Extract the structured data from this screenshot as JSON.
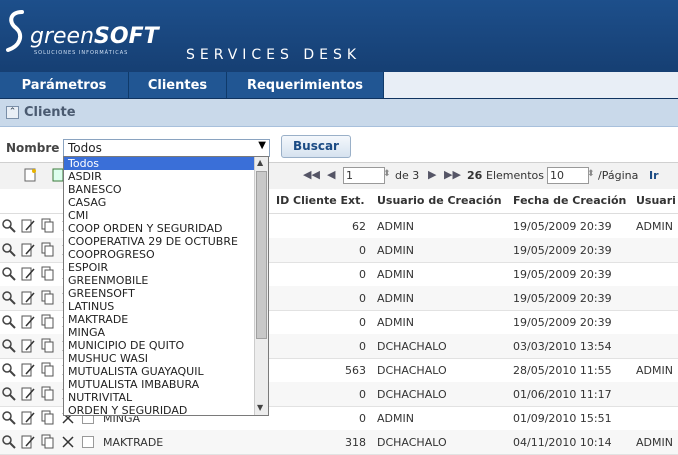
{
  "brand": {
    "name_a": "green",
    "name_b": "SOFT",
    "tagline": "SOLUCIONES INFORMÁTICAS",
    "app_title": "SERVICES DESK"
  },
  "nav": [
    "Parámetros",
    "Clientes",
    "Requerimientos"
  ],
  "section": {
    "title": "Cliente"
  },
  "filter": {
    "label": "Nombre",
    "selected": "Todos",
    "search_label": "Buscar"
  },
  "dropdown": {
    "options": [
      "Todos",
      "ASDIR",
      "BANESCO",
      "CASAG",
      "CMI",
      "COOP ORDEN Y SEGURIDAD",
      "COOPERATIVA 29 DE OCTUBRE",
      "COOPROGRESO",
      "ESPOIR",
      "GREENMOBILE",
      "GREENSOFT",
      "LATINUS",
      "MAKTRADE",
      "MINGA",
      "MUNICIPIO DE QUITO",
      "MUSHUC WASI",
      "MUTUALISTA GUAYAQUIL",
      "MUTUALISTA IMBABURA",
      "NUTRIVITAL",
      "ORDEN Y SEGURIDAD"
    ]
  },
  "pager": {
    "page": "1",
    "of_label": "de 3",
    "count": "26",
    "elements_label": "Elementos",
    "per_page": "10",
    "per_page_label": "/Página",
    "go_label": "Ir"
  },
  "columns": [
    "ID Cliente Ext.",
    "Usuario de Creación",
    "Fecha de Creación",
    "Usuari"
  ],
  "rows": [
    {
      "name": "",
      "id": "62",
      "user": "ADMIN",
      "date": "19/05/2009 20:39",
      "user2": "ADMIN"
    },
    {
      "name": "",
      "id": "0",
      "user": "ADMIN",
      "date": "19/05/2009 20:39",
      "user2": ""
    },
    {
      "name": "",
      "id": "0",
      "user": "ADMIN",
      "date": "19/05/2009 20:39",
      "user2": ""
    },
    {
      "name": "",
      "id": "0",
      "user": "ADMIN",
      "date": "19/05/2009 20:39",
      "user2": ""
    },
    {
      "name": "",
      "id": "0",
      "user": "ADMIN",
      "date": "19/05/2009 20:39",
      "user2": ""
    },
    {
      "name": "",
      "id": "0",
      "user": "DCHACHALO",
      "date": "03/03/2010 13:54",
      "user2": ""
    },
    {
      "name": "",
      "id": "563",
      "user": "DCHACHALO",
      "date": "28/05/2010 11:55",
      "user2": "ADMIN"
    },
    {
      "name": "",
      "id": "0",
      "user": "DCHACHALO",
      "date": "01/06/2010 11:17",
      "user2": ""
    },
    {
      "name": "MINGA",
      "id": "0",
      "user": "ADMIN",
      "date": "01/09/2010 15:51",
      "user2": ""
    },
    {
      "name": "MAKTRADE",
      "id": "318",
      "user": "DCHACHALO",
      "date": "04/11/2010 10:14",
      "user2": "ADMIN"
    }
  ]
}
